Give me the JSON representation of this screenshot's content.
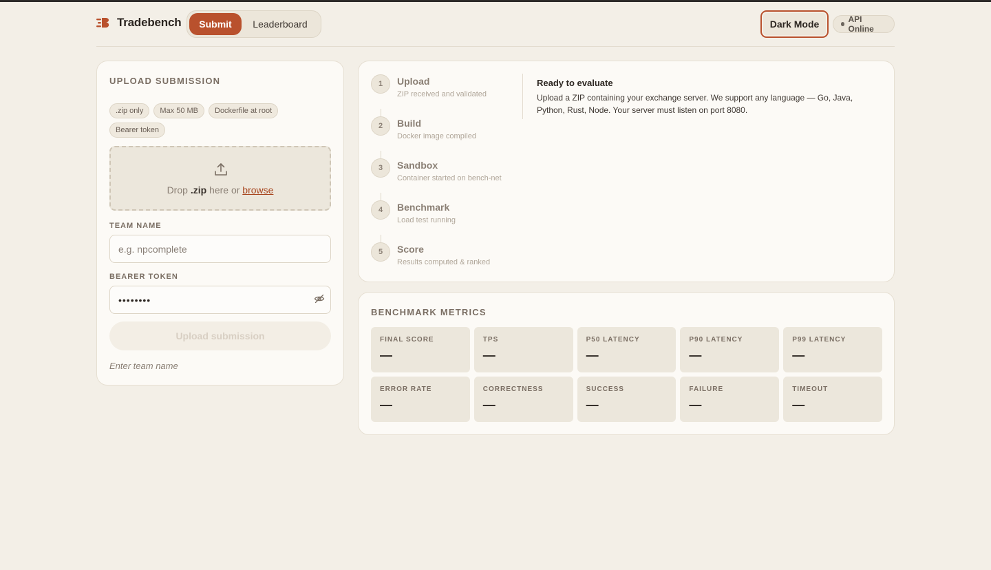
{
  "header": {
    "brand": "Tradebench",
    "tabs": [
      {
        "label": "Submit",
        "active": true
      },
      {
        "label": "Leaderboard",
        "active": false
      }
    ],
    "dark_mode_label": "Dark Mode",
    "api_status": "API Online"
  },
  "colors": {
    "accent": "#b9512d",
    "background": "#f3efe7",
    "card": "#fcfaf6"
  },
  "upload": {
    "title": "UPLOAD SUBMISSION",
    "chips": [
      ".zip only",
      "Max 50 MB",
      "Dockerfile at root",
      "Bearer token"
    ],
    "dropzone": {
      "icon": "upload-icon",
      "prefix": "Drop",
      "ext": ".zip",
      "middle": "here or",
      "link": "browse"
    },
    "team_label": "TEAM NAME",
    "team_placeholder": "e.g. npcomplete",
    "team_value": "",
    "token_label": "BEARER TOKEN",
    "token_value": "••••••••",
    "token_icon": "eye-off-icon",
    "button_label": "Upload submission",
    "hint": "Enter team name"
  },
  "pipeline": {
    "steps": [
      {
        "num": "1",
        "name": "Upload",
        "desc": "ZIP received and validated"
      },
      {
        "num": "2",
        "name": "Build",
        "desc": "Docker image compiled"
      },
      {
        "num": "3",
        "name": "Sandbox",
        "desc": "Container started on bench-net"
      },
      {
        "num": "4",
        "name": "Benchmark",
        "desc": "Load test running"
      },
      {
        "num": "5",
        "name": "Score",
        "desc": "Results computed & ranked"
      }
    ],
    "status_title": "Ready to evaluate",
    "status_desc": "Upload a ZIP containing your exchange server. We support any language — Go, Java, Python, Rust, Node. Your server must listen on port 8080."
  },
  "metrics": {
    "title": "BENCHMARK METRICS",
    "items": [
      {
        "label": "FINAL SCORE",
        "value": "—"
      },
      {
        "label": "TPS",
        "value": "—"
      },
      {
        "label": "P50 LATENCY",
        "value": "—"
      },
      {
        "label": "P90 LATENCY",
        "value": "—"
      },
      {
        "label": "P99 LATENCY",
        "value": "—"
      },
      {
        "label": "ERROR RATE",
        "value": "—"
      },
      {
        "label": "CORRECTNESS",
        "value": "—"
      },
      {
        "label": "SUCCESS",
        "value": "—"
      },
      {
        "label": "FAILURE",
        "value": "—"
      },
      {
        "label": "TIMEOUT",
        "value": "—"
      }
    ]
  }
}
